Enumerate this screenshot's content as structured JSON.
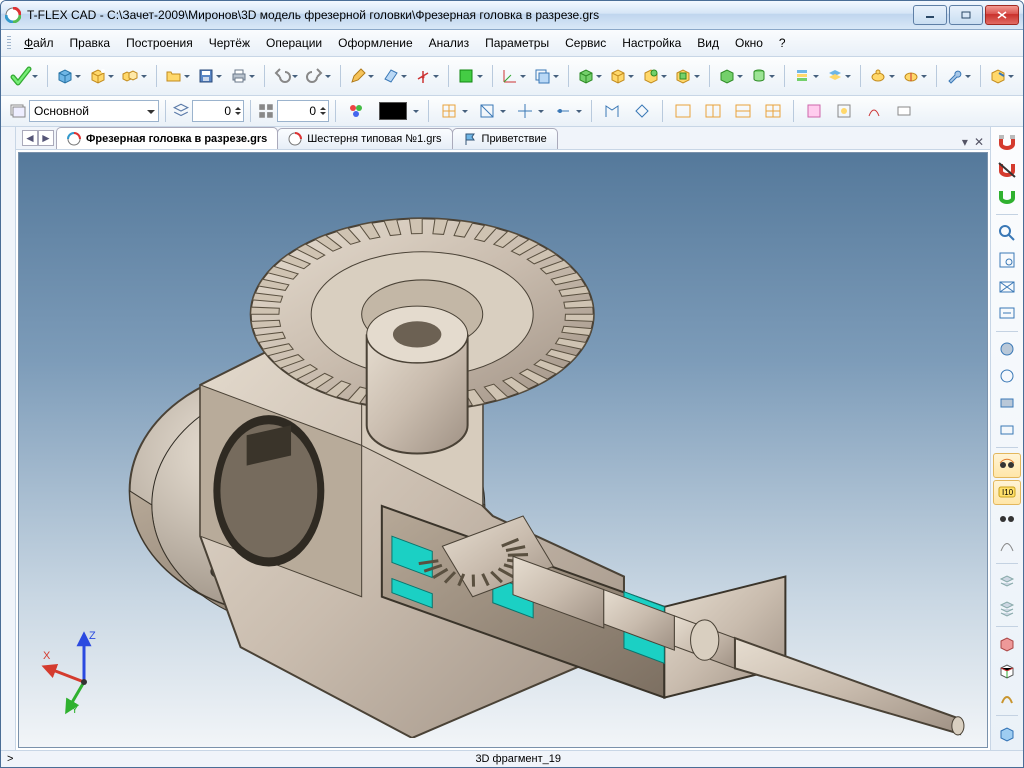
{
  "window": {
    "app": "T-FLEX CAD",
    "path": "C:\\Зачет-2009\\Миронов\\3D модель фрезерной головки\\Фрезерная головка в разрезе.grs"
  },
  "menu": {
    "items": [
      "Файл",
      "Правка",
      "Построения",
      "Чертёж",
      "Операции",
      "Оформление",
      "Анализ",
      "Параметры",
      "Сервис",
      "Настройка",
      "Вид",
      "Окно",
      "?"
    ]
  },
  "toolbar_row1": {
    "icons": [
      "apply",
      "new-doc",
      "new-3d",
      "new-2d",
      "open",
      "save",
      "print",
      "sep",
      "undo",
      "redo",
      "sep",
      "sketch",
      "plane",
      "axis",
      "sep",
      "region",
      "sep",
      "cs-xy",
      "cs-xz",
      "sep",
      "bool-union",
      "bool-subtract",
      "bool-intersect",
      "bool-cut",
      "sep",
      "solid-cube",
      "solid-sweep",
      "sep",
      "stack",
      "stack2",
      "sep",
      "teapot",
      "teapot-cut",
      "sep",
      "tool-1",
      "sep",
      "tool-2"
    ]
  },
  "toolbar_row2": {
    "layer_label": "Основной",
    "spin1": "0",
    "spin2": "0",
    "icons_mid": [
      "color-picker",
      "swatch",
      "sep",
      "view-1",
      "view-2",
      "view-3",
      "view-4",
      "sep",
      "nav-1",
      "nav-2",
      "sep",
      "win-a",
      "win-b",
      "win-c",
      "win-d",
      "sep",
      "misc-1",
      "misc-2",
      "misc-3",
      "misc-4"
    ]
  },
  "tabs": {
    "items": [
      {
        "label": "Фрезерная головка в разрезе.grs",
        "icon": "model-icon",
        "active": true
      },
      {
        "label": "Шестерня типовая №1.grs",
        "icon": "model-icon",
        "active": false
      },
      {
        "label": "Приветствие",
        "icon": "flag-icon",
        "active": false
      }
    ]
  },
  "right_panel": {
    "groups": [
      [
        "magnet-red",
        "magnet-off",
        "magnet-green"
      ],
      [
        "zoom-all",
        "zoom-win",
        "fit-geom",
        "fit-sel"
      ],
      [
        "shade-1",
        "shade-2",
        "shade-3",
        "shade-4"
      ],
      [
        "eye-1",
        "eye-2",
        "eye-3",
        "eye-4"
      ],
      [
        "layers-1",
        "layers-2"
      ],
      [
        "cube-1",
        "cube-2",
        "ucs"
      ],
      [
        "persp"
      ]
    ],
    "selected": [
      "eye-1",
      "eye-2"
    ]
  },
  "triad": {
    "x": "X",
    "y": "Y",
    "z": "Z"
  },
  "statusbar": {
    "left": ">",
    "center": "3D фрагмент_19"
  },
  "colors": {
    "accent": "#2e6fb3",
    "gear": "#c9bcae",
    "bearing": "#1bd0c4"
  }
}
